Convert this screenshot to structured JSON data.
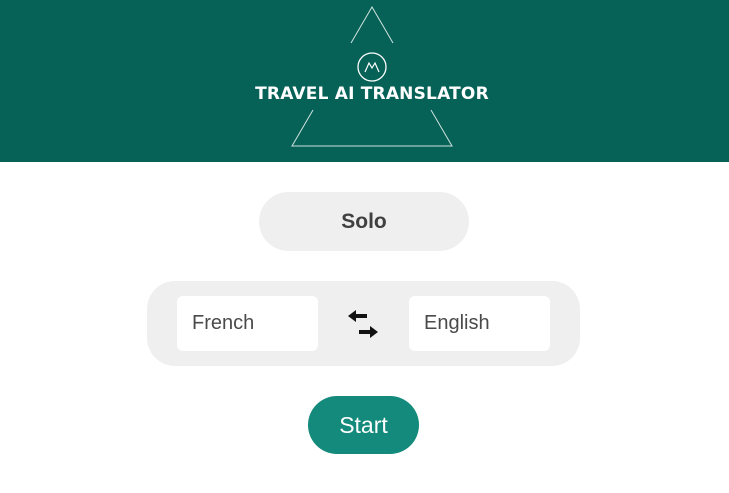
{
  "header": {
    "title": "TRAVEL AI TRANSLATOR",
    "background_color": "#066157",
    "logo_icon": "mountain-circle-icon"
  },
  "mode": {
    "label": "Solo"
  },
  "languages": {
    "source": "French",
    "target": "English",
    "swap_icon": "swap-arrows-icon"
  },
  "start": {
    "label": "Start",
    "color": "#138a7b"
  }
}
